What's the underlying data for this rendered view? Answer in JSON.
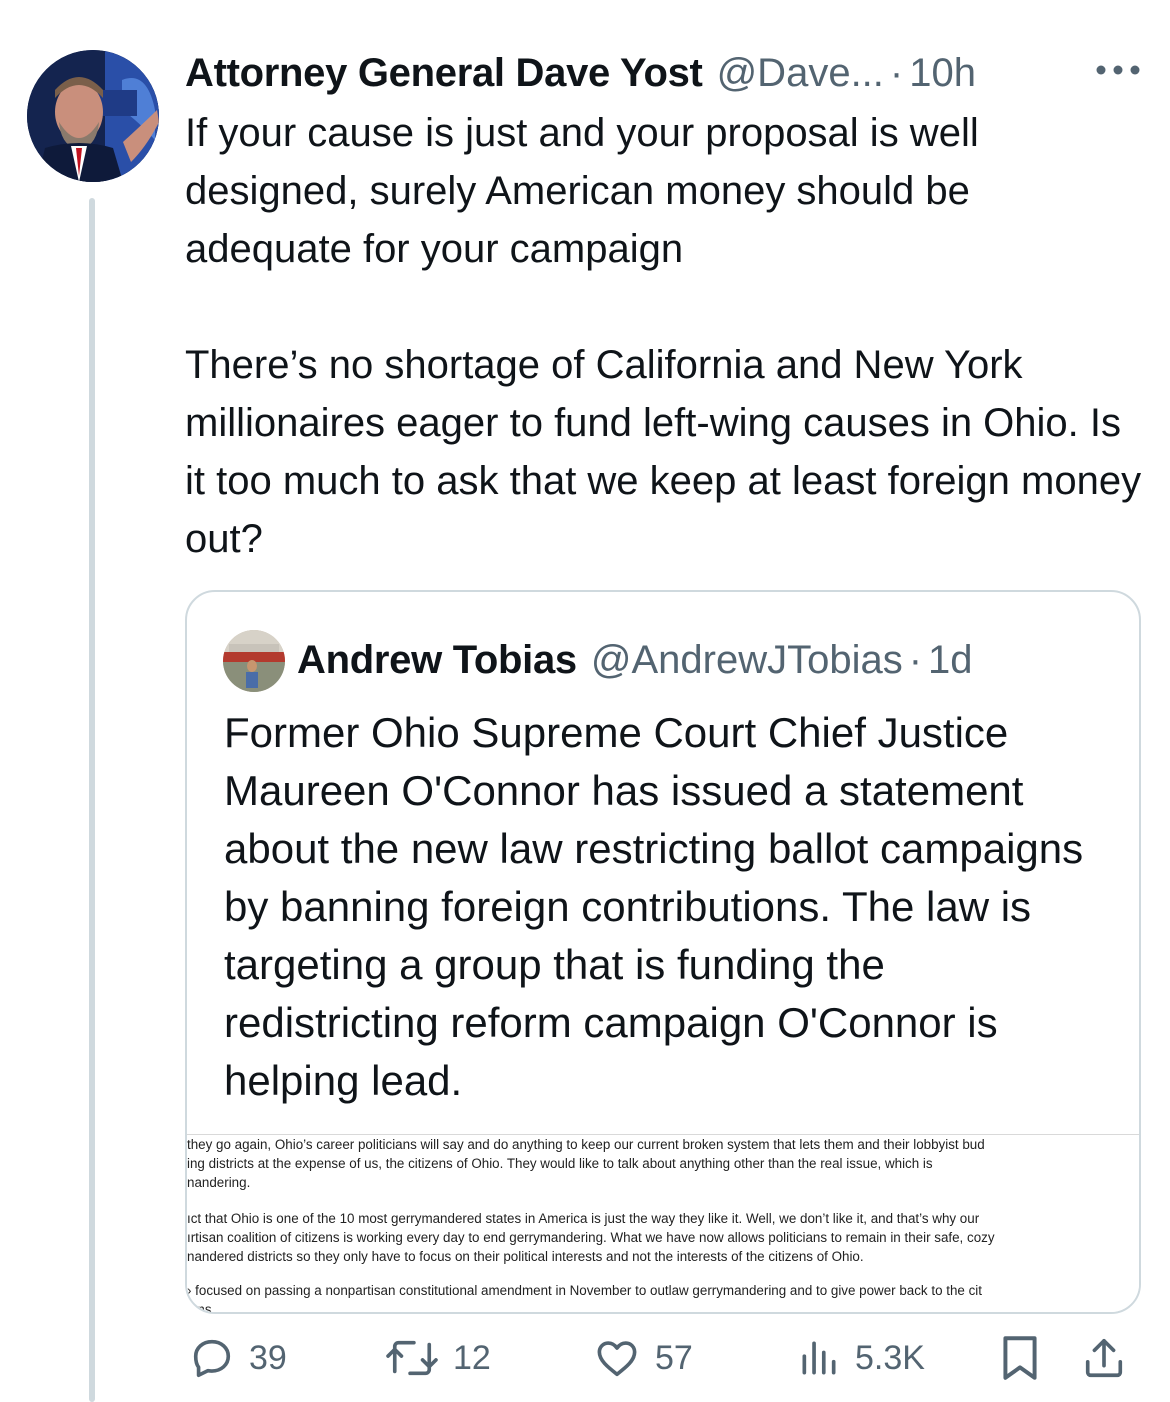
{
  "tweet": {
    "author_name": "Attorney General Dave Yost",
    "author_handle": "@Dave...",
    "separator": "·",
    "time": "10h",
    "paragraphs": [
      "If your cause is just and your proposal is well designed, surely American money should be adequate for your campaign",
      "There’s no shortage of California and New York millionaires eager to fund left-wing causes in Ohio. Is it too much to ask that we keep at least foreign money out?"
    ],
    "more_icon": "more-horizontal-icon"
  },
  "quoted": {
    "author_name": "Andrew Tobias",
    "author_handle": "@AndrewJTobias",
    "separator": "·",
    "time": "1d",
    "text": "Former Ohio Supreme Court Chief Justice Maureen O'Connor has issued a statement about the new law restricting ballot campaigns by banning foreign contributions. The law is targeting a group that is funding the redistricting reform campaign O'Connor is helping lead.",
    "document_lines": {
      "p1": [
        "they go again, Ohio’s career politicians will say and do anything to keep our current broken system that lets them and their lobbyist bud",
        "ing districts at the expense of us, the citizens of Ohio. They would like to talk about anything other than the real issue, which is",
        "nandering."
      ],
      "p2": [
        "ıct that Ohio is one of the 10 most gerrymandered states in America is just the way they like it. Well, we don’t like it, and that’s why our",
        "ırtisan coalition of citizens is working every day to end gerrymandering. What we have now allows politicians to remain in their safe, cozy",
        "nandered districts so they only have to focus on their political interests and not the interests of the citizens of Ohio."
      ],
      "p3": [
        "› focused on passing a nonpartisan constitutional amendment in November to outlaw gerrymandering and to give power back to the cit",
        "ions"
      ]
    }
  },
  "actions": {
    "replies": "39",
    "retweets": "12",
    "likes": "57",
    "views": "5.3K"
  },
  "colors": {
    "text": "#0f1419",
    "secondary": "#536471",
    "border": "#cfd9de"
  }
}
